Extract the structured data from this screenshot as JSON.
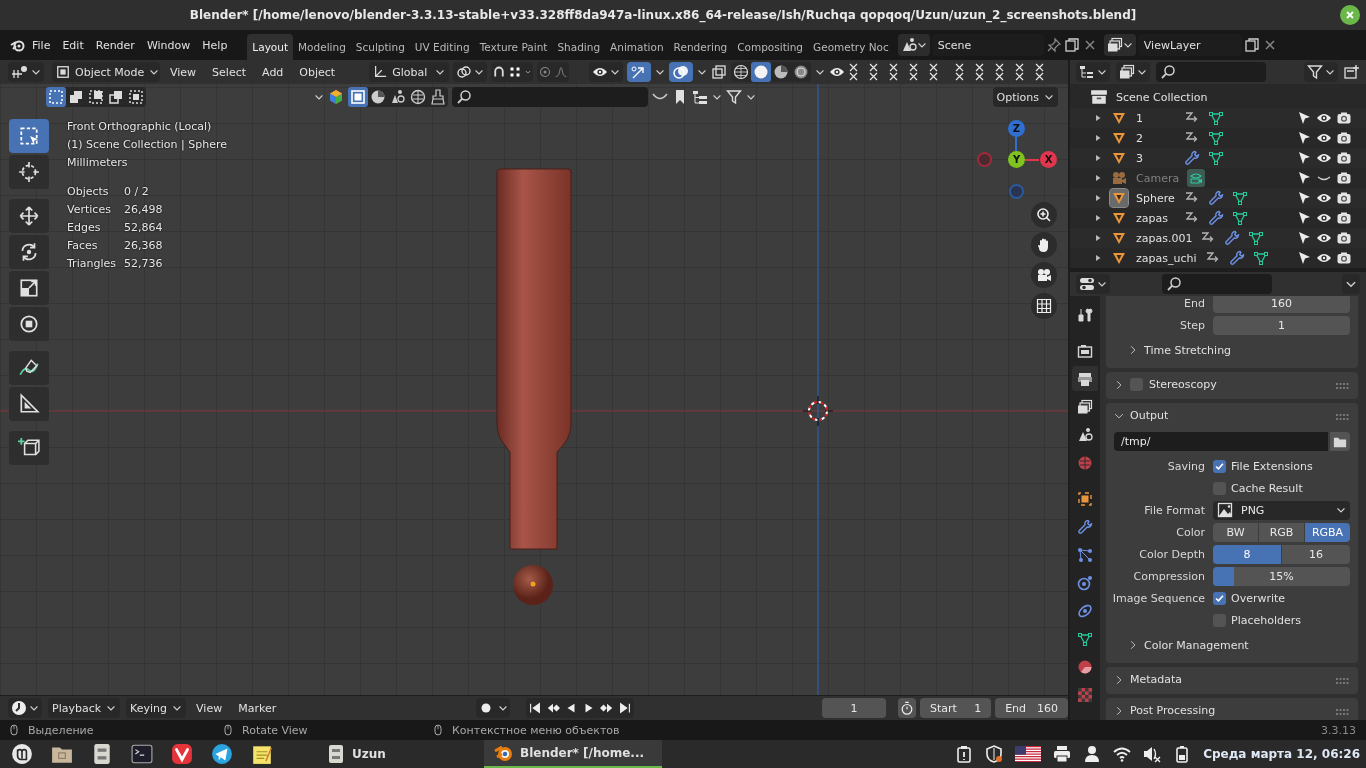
{
  "window": {
    "title": "Blender* [/home/lenovo/blender-3.3.13-stable+v33.328ff8da947a-linux.x86_64-release/Ish/Ruchqa qopqoq/Uzun/uzun_2_screenshots.blend]"
  },
  "menu": [
    "File",
    "Edit",
    "Render",
    "Window",
    "Help"
  ],
  "workspaces": [
    {
      "label": "Layout",
      "selected": true
    },
    {
      "label": "Modeling",
      "selected": false
    },
    {
      "label": "Sculpting",
      "selected": false
    },
    {
      "label": "UV Editing",
      "selected": false
    },
    {
      "label": "Texture Paint",
      "selected": false
    },
    {
      "label": "Shading",
      "selected": false
    },
    {
      "label": "Animation",
      "selected": false
    },
    {
      "label": "Rendering",
      "selected": false
    },
    {
      "label": "Compositing",
      "selected": false
    },
    {
      "label": "Geometry Noc",
      "selected": false
    }
  ],
  "scene": {
    "value": "Scene"
  },
  "view_layer": {
    "value": "ViewLayer"
  },
  "viewport": {
    "mode": "Object Mode",
    "menus": [
      "View",
      "Select",
      "Add",
      "Object"
    ],
    "orientation": "Global",
    "gizmos_on": true,
    "overlays_on": true,
    "shading": [
      {
        "selected": false
      },
      {
        "selected": true
      },
      {
        "selected": false
      },
      {
        "selected": false
      }
    ],
    "select_modes": [
      {
        "selected": true
      },
      {
        "selected": false
      },
      {
        "selected": false
      },
      {
        "selected": false
      },
      {
        "selected": false
      }
    ],
    "filters": [
      {
        "selected": true
      },
      {
        "selected": false
      },
      {
        "selected": false
      },
      {
        "selected": false
      },
      {
        "selected": false
      }
    ],
    "options": "Options",
    "info": [
      "Front Orthographic (Local)",
      "(1) Scene Collection | Sphere",
      "Millimeters"
    ],
    "stats": [
      {
        "label": "Objects",
        "value": "0 / 2"
      },
      {
        "label": "Vertices",
        "value": "26,498"
      },
      {
        "label": "Edges",
        "value": "52,864"
      },
      {
        "label": "Faces",
        "value": "26,368"
      },
      {
        "label": "Triangles",
        "value": "52,736"
      }
    ],
    "tools": [
      {
        "kind": "select_box",
        "selected": true
      },
      {
        "kind": "cursor",
        "selected": false
      },
      {
        "kind": "move",
        "selected": false
      },
      {
        "kind": "rotate",
        "selected": false
      },
      {
        "kind": "scale",
        "selected": false
      },
      {
        "kind": "transform",
        "selected": false
      },
      {
        "kind": "annotate",
        "selected": false
      },
      {
        "kind": "measure",
        "selected": false
      },
      {
        "kind": "add_cube",
        "selected": false
      }
    ],
    "gizmo": [
      {
        "label": "Z",
        "color": "#2e6fd0"
      },
      {
        "label": "Y",
        "color": "#80c21f"
      },
      {
        "label": "X",
        "color": "#e0364e"
      }
    ]
  },
  "timeline": {
    "menus": [
      "Playback",
      "Keying"
    ],
    "plain_menus": [
      "View",
      "Marker"
    ],
    "current_frame": "1",
    "start_label": "Start",
    "start": "1",
    "end_label": "End",
    "end": "160"
  },
  "outliner": {
    "root": "Scene Collection",
    "items": [
      {
        "name": "1",
        "kind": "mesh",
        "constraint": true,
        "modifier": false,
        "active": false,
        "disabled": false,
        "visible": true
      },
      {
        "name": "2",
        "kind": "mesh",
        "constraint": true,
        "modifier": false,
        "active": false,
        "disabled": false,
        "visible": true
      },
      {
        "name": "3",
        "kind": "mesh",
        "constraint": false,
        "modifier": true,
        "active": false,
        "disabled": false,
        "visible": true
      },
      {
        "name": "Camera",
        "kind": "camera",
        "constraint": false,
        "modifier": false,
        "active": false,
        "disabled": true,
        "visible": false
      },
      {
        "name": "Sphere",
        "kind": "mesh",
        "constraint": true,
        "modifier": true,
        "active": true,
        "disabled": false,
        "visible": true
      },
      {
        "name": "zapas",
        "kind": "mesh",
        "constraint": true,
        "modifier": true,
        "active": false,
        "disabled": false,
        "visible": true
      },
      {
        "name": "zapas.001",
        "kind": "mesh",
        "constraint": true,
        "modifier": true,
        "active": false,
        "disabled": false,
        "visible": true
      },
      {
        "name": "zapas_uchi",
        "kind": "mesh",
        "constraint": true,
        "modifier": true,
        "active": false,
        "disabled": false,
        "visible": true
      }
    ]
  },
  "properties": {
    "tabs": [
      {
        "kind": "tool",
        "selected": false
      },
      {
        "kind": "render",
        "selected": false
      },
      {
        "kind": "output",
        "selected": true
      },
      {
        "kind": "view_layer",
        "selected": false
      },
      {
        "kind": "scene",
        "selected": false
      },
      {
        "kind": "world",
        "selected": false
      },
      {
        "kind": "object",
        "selected": false
      },
      {
        "kind": "modifier",
        "selected": false
      },
      {
        "kind": "particles",
        "selected": false
      },
      {
        "kind": "physics",
        "selected": false
      },
      {
        "kind": "constraints",
        "selected": false
      },
      {
        "kind": "data",
        "selected": false
      },
      {
        "kind": "material",
        "selected": false
      },
      {
        "kind": "texture",
        "selected": false
      }
    ],
    "panels": [
      {
        "rows": [
          {
            "kind": "number",
            "label": "End",
            "value": "160"
          },
          {
            "kind": "number",
            "label": "Step",
            "value": "1"
          },
          {
            "kind": "subpanel",
            "label": "Time Stretching",
            "expanded": false
          }
        ]
      },
      {
        "label": "Stereoscopy",
        "expanded": false,
        "checked": false
      },
      {
        "label": "Output",
        "expanded": true,
        "rows": [
          {
            "kind": "path",
            "value": "/tmp/"
          },
          {
            "kind": "check",
            "label": "Saving",
            "text": "File Extensions",
            "checked": true
          },
          {
            "kind": "check",
            "text": "Cache Result",
            "checked": false
          },
          {
            "kind": "dropdown",
            "label": "File Format",
            "value": "PNG"
          },
          {
            "kind": "segmented",
            "label": "Color",
            "options": [
              {
                "label": "BW",
                "selected": false
              },
              {
                "label": "RGB",
                "selected": false
              },
              {
                "label": "RGBA",
                "selected": true
              }
            ]
          },
          {
            "kind": "segmented",
            "label": "Color Depth",
            "options": [
              {
                "label": "8",
                "selected": true
              },
              {
                "label": "16",
                "selected": false
              }
            ]
          },
          {
            "kind": "slider",
            "label": "Compression",
            "value": "15%",
            "level": 0.15
          },
          {
            "kind": "check",
            "label": "Image Sequence",
            "text": "Overwrite",
            "checked": true
          },
          {
            "kind": "check",
            "text": "Placeholders",
            "checked": false
          },
          {
            "kind": "subpanel",
            "label": "Color Management",
            "expanded": false
          }
        ]
      },
      {
        "label": "Metadata",
        "expanded": false
      },
      {
        "label": "Post Processing",
        "expanded": false
      }
    ]
  },
  "status_bar": {
    "hints": [
      "Выделение",
      "Rotate View",
      "Контекстное меню объектов"
    ],
    "version": "3.3.13"
  },
  "taskbar": {
    "windows": [
      {
        "label": "Uzun",
        "selected": false
      },
      {
        "label": "Blender* [/home...",
        "selected": true
      }
    ],
    "clock": "Среда марта 12, 06:26"
  }
}
